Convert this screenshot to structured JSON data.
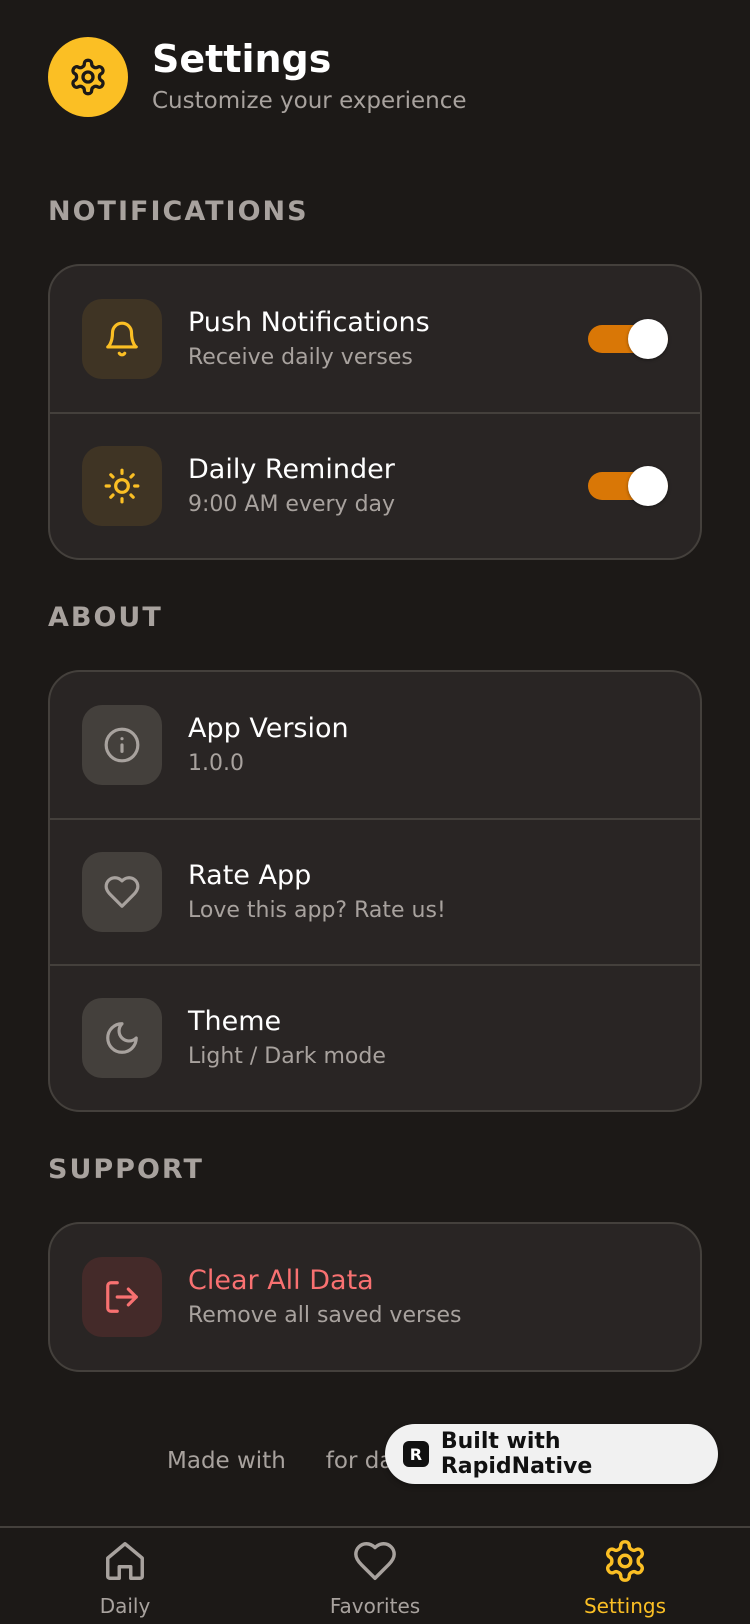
{
  "header": {
    "title": "Settings",
    "subtitle": "Customize your experience",
    "icon": "gear-icon",
    "accent_color": "#fbbf24"
  },
  "sections": {
    "notifications": {
      "label": "NOTIFICATIONS",
      "items": [
        {
          "title": "Push Notifications",
          "subtitle": "Receive daily verses",
          "icon": "bell-icon",
          "toggle_on": true
        },
        {
          "title": "Daily Reminder",
          "subtitle": "9:00 AM every day",
          "icon": "sun-icon",
          "toggle_on": true
        }
      ]
    },
    "about": {
      "label": "ABOUT",
      "items": [
        {
          "title": "App Version",
          "subtitle": "1.0.0",
          "icon": "info-icon"
        },
        {
          "title": "Rate App",
          "subtitle": "Love this app? Rate us!",
          "icon": "heart-icon"
        },
        {
          "title": "Theme",
          "subtitle": "Light / Dark mode",
          "icon": "moon-icon"
        }
      ]
    },
    "support": {
      "label": "SUPPORT",
      "items": [
        {
          "title": "Clear All Data",
          "subtitle": "Remove all saved verses",
          "icon": "logout-icon",
          "danger_color": "#f87171"
        }
      ]
    }
  },
  "footer": {
    "made_with": "Made with",
    "for_text": "for daily"
  },
  "badge": {
    "logo": "R",
    "text": "Built with RapidNative"
  },
  "tabbar": {
    "tabs": [
      {
        "label": "Daily",
        "icon": "home-icon"
      },
      {
        "label": "Favorites",
        "icon": "heart-icon"
      },
      {
        "label": "Settings",
        "icon": "gear-icon",
        "active": true
      }
    ]
  },
  "colors": {
    "background": "#1c1917",
    "card": "#292524",
    "toggle_on": "#d97706"
  }
}
